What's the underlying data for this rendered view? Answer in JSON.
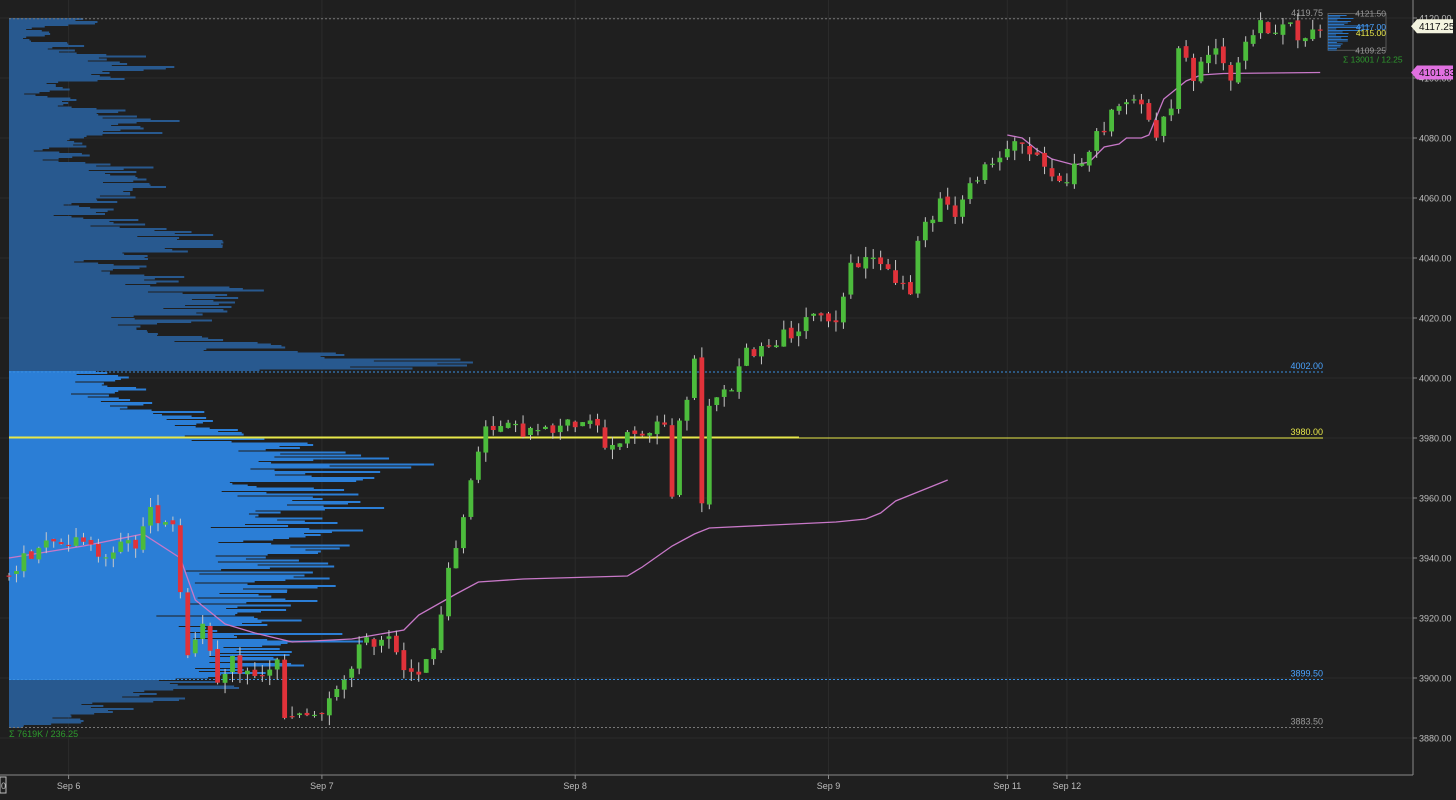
{
  "colors": {
    "background": "#1f1f1f",
    "grid": "#2b2b2b",
    "axis_text": "#bdbdbd",
    "candle_up": "#4cbb3c",
    "candle_down": "#e0323a",
    "wick": "#c8c8c8",
    "vwap": "#c878c8",
    "profile_value_area": "#2b7ed6",
    "profile_outside": "#28598f",
    "poc": "#e8e84a",
    "va_line": "#3a8fe0",
    "level_text_blue": "#4aa3ff",
    "level_text_yellow": "#e8e84a",
    "level_text_gray": "#9a9a9a",
    "stats_text": "#2e9a2e",
    "price_badge": "#f4f4e0",
    "vwap_badge": "#e070e0"
  },
  "chart_data": {
    "type": "candlestick",
    "title": "",
    "y_axis": {
      "range": [
        3874,
        4123
      ],
      "ticks": [
        3880.0,
        3900.0,
        3920.0,
        3940.0,
        3960.0,
        3980.0,
        4000.0,
        4020.0,
        4040.0,
        4060.0,
        4080.0,
        4100.0,
        4120.0
      ],
      "tick_labels": [
        "3880.00",
        "3900.00",
        "3920.00",
        "3940.00",
        "3960.00",
        "3980.00",
        "4000.00",
        "4020.00",
        "4040.00",
        "4060.00",
        "4080.00",
        "4100.00",
        "4120.00"
      ]
    },
    "x_axis": {
      "labels": [
        "Sep 6",
        "Sep 7",
        "Sep 8",
        "Sep 9",
        "Sep 11",
        "Sep 12"
      ],
      "label_index": [
        8,
        42,
        76,
        110,
        134,
        142
      ],
      "bar_count": 177
    },
    "levels": [
      {
        "name": "value-area-high",
        "value": 4002.0,
        "label": "4002.00",
        "style": "blue"
      },
      {
        "name": "poc",
        "value": 3980.0,
        "label": "3980.00",
        "style": "yellow"
      },
      {
        "name": "value-area-low",
        "value": 3899.5,
        "label": "3899.50",
        "style": "blue"
      },
      {
        "name": "profile-low",
        "value": 3883.5,
        "label": "3883.50",
        "style": "gray"
      },
      {
        "name": "profile-high",
        "value": 4119.75,
        "label": "4119.75",
        "style": "gray"
      }
    ],
    "profile_stats": "Σ 7619K / 236.25",
    "value_area": [
      3899.5,
      4002.0
    ],
    "poc": 3980.0,
    "profile_range": [
      3883.5,
      4119.75
    ],
    "current_price": {
      "value": 4117.25,
      "label": "4117.25"
    },
    "vwap_last": {
      "value": 4101.83,
      "label": "4101.83"
    },
    "mini_profile": {
      "high_label": "4121.50",
      "poc_label": "4117.00",
      "mid_label": "4115.00",
      "low_label": "4109.25",
      "stats": "Σ 13001 / 12.25"
    },
    "axis_corner_label": "0",
    "anchors": [
      [
        0,
        3936
      ],
      [
        6,
        3948
      ],
      [
        12,
        3942
      ],
      [
        17,
        3945
      ],
      [
        19,
        3955
      ],
      [
        22,
        3952
      ],
      [
        24,
        3908
      ],
      [
        26,
        3920
      ],
      [
        28,
        3896
      ],
      [
        30,
        3905
      ],
      [
        33,
        3900
      ],
      [
        36,
        3905
      ],
      [
        37,
        3886
      ],
      [
        42,
        3888
      ],
      [
        44,
        3895
      ],
      [
        47,
        3910
      ],
      [
        51,
        3915
      ],
      [
        53,
        3905
      ],
      [
        55,
        3900
      ],
      [
        57,
        3910
      ],
      [
        59,
        3935
      ],
      [
        61,
        3955
      ],
      [
        63,
        3975
      ],
      [
        64,
        3985
      ],
      [
        67,
        3983
      ],
      [
        72,
        3982
      ],
      [
        74,
        3983
      ],
      [
        78,
        3988
      ],
      [
        80,
        3978
      ],
      [
        83,
        3980
      ],
      [
        86,
        3982
      ],
      [
        88,
        3985
      ],
      [
        89,
        3960
      ],
      [
        90,
        3985
      ],
      [
        92,
        4005
      ],
      [
        93,
        3960
      ],
      [
        94,
        3990
      ],
      [
        97,
        3997
      ],
      [
        99,
        4008
      ],
      [
        103,
        4013
      ],
      [
        107,
        4018
      ],
      [
        109,
        4022
      ],
      [
        111,
        4018
      ],
      [
        113,
        4038
      ],
      [
        117,
        4040
      ],
      [
        121,
        4028
      ],
      [
        122,
        4045
      ],
      [
        125,
        4060
      ],
      [
        127,
        4055
      ],
      [
        130,
        4068
      ],
      [
        132,
        4070
      ],
      [
        135,
        4080
      ],
      [
        136,
        4078
      ],
      [
        141,
        4065
      ],
      [
        144,
        4072
      ],
      [
        146,
        4080
      ],
      [
        149,
        4092
      ],
      [
        152,
        4090
      ],
      [
        154,
        4082
      ],
      [
        156,
        4090
      ],
      [
        157,
        4112
      ],
      [
        159,
        4100
      ],
      [
        162,
        4112
      ],
      [
        164,
        4100
      ],
      [
        166,
        4113
      ],
      [
        168,
        4117
      ],
      [
        172,
        4117
      ],
      [
        173,
        4113
      ],
      [
        176,
        4117
      ]
    ],
    "vwap_sep6": [
      [
        0,
        3940
      ],
      [
        10,
        3944
      ],
      [
        18,
        3948
      ],
      [
        23,
        3940
      ],
      [
        25,
        3926
      ],
      [
        29,
        3918
      ],
      [
        33,
        3915
      ],
      [
        38,
        3912
      ],
      [
        46,
        3913
      ],
      [
        53,
        3916
      ],
      [
        55,
        3921
      ],
      [
        60,
        3928
      ],
      [
        63,
        3932
      ],
      [
        69,
        3933
      ],
      [
        83,
        3934
      ],
      [
        85,
        3937
      ],
      [
        89,
        3944
      ],
      [
        92,
        3948
      ],
      [
        94,
        3950
      ],
      [
        111,
        3952
      ],
      [
        115,
        3953
      ],
      [
        117,
        3955
      ],
      [
        119,
        3959
      ],
      [
        123,
        3963
      ],
      [
        125,
        3965
      ],
      [
        126,
        3966
      ]
    ],
    "vwap_sep11": [
      [
        134,
        4081
      ],
      [
        136,
        4080
      ],
      [
        138,
        4076
      ],
      [
        140,
        4073
      ],
      [
        143,
        4071
      ],
      [
        145,
        4072
      ],
      [
        147,
        4077
      ],
      [
        149,
        4078
      ],
      [
        150,
        4080
      ],
      [
        152,
        4080
      ],
      [
        153,
        4081
      ],
      [
        155,
        4093
      ],
      [
        158,
        4099
      ],
      [
        160,
        4101
      ],
      [
        163,
        4101.5
      ],
      [
        176,
        4101.83
      ]
    ]
  }
}
